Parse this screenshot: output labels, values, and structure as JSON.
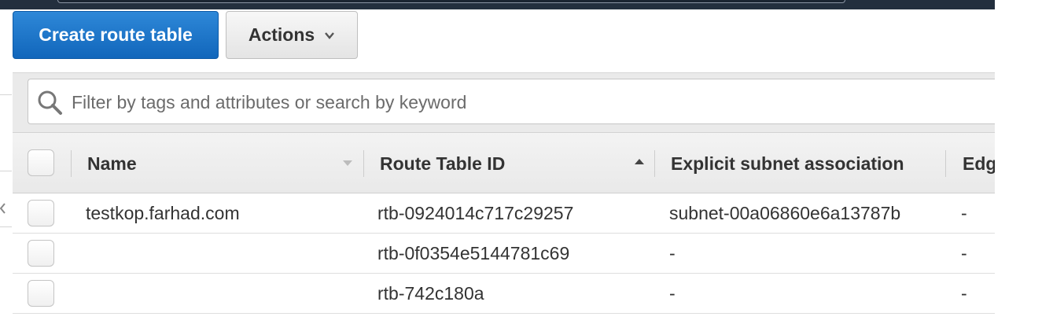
{
  "toolbar": {
    "create_label": "Create route table",
    "actions_label": "Actions"
  },
  "filter": {
    "placeholder": "Filter by tags and attributes or search by keyword"
  },
  "table": {
    "columns": [
      "Name",
      "Route Table ID",
      "Explicit subnet association",
      "Edg"
    ],
    "rows": [
      {
        "name": "testkop.farhad.com",
        "route_table_id": "rtb-0924014c717c29257",
        "explicit_subnet_association": "subnet-00a06860e6a13787b",
        "edge": "-"
      },
      {
        "name": "",
        "route_table_id": "rtb-0f0354e5144781c69",
        "explicit_subnet_association": "-",
        "edge": "-"
      },
      {
        "name": "",
        "route_table_id": "rtb-742c180a",
        "explicit_subnet_association": "-",
        "edge": "-"
      }
    ]
  },
  "colors": {
    "primary_button": "#1166bb",
    "header_bar": "#232f3e",
    "table_header_bg": "#eeeeee"
  },
  "icons": {
    "search": "search-icon",
    "actions_caret": "chevron-down-icon",
    "name_sort": "sort-descending-icon",
    "id_sort": "sort-ascending-icon"
  }
}
